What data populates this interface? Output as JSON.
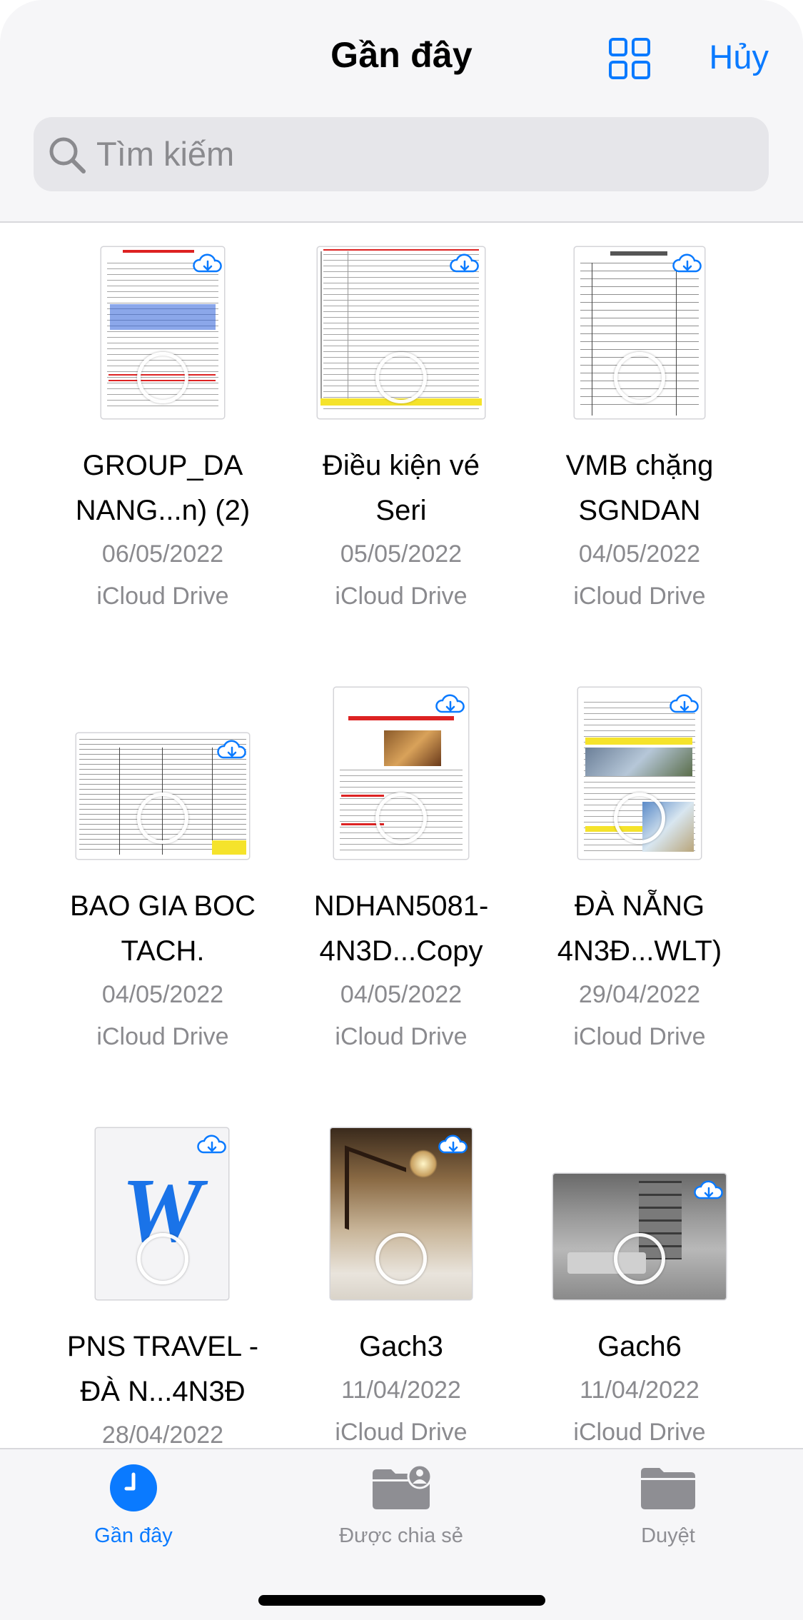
{
  "header": {
    "title": "Gần đây",
    "grid_icon": "grid-view-icon",
    "cancel_label": "Hủy"
  },
  "search": {
    "icon": "search-icon",
    "placeholder": "Tìm kiếm"
  },
  "files": [
    {
      "name_line1": "GROUP_DA",
      "name_line2": "NANG...n) (2)",
      "date": "06/05/2022",
      "location": "iCloud Drive",
      "thumb": "document"
    },
    {
      "name_line1": "Điều kiện vé",
      "name_line2": "Seri",
      "date": "05/05/2022",
      "location": "iCloud Drive",
      "thumb": "document"
    },
    {
      "name_line1": "VMB chặng",
      "name_line2": "SGNDAN",
      "date": "04/05/2022",
      "location": "iCloud Drive",
      "thumb": "document"
    },
    {
      "name_line1": "BAO GIA BOC",
      "name_line2": "TACH.",
      "date": "04/05/2022",
      "location": "iCloud Drive",
      "thumb": "spreadsheet"
    },
    {
      "name_line1": "NDHAN5081-",
      "name_line2": "4N3D...Copy",
      "date": "04/05/2022",
      "location": "iCloud Drive",
      "thumb": "document"
    },
    {
      "name_line1": "ĐÀ NẴNG",
      "name_line2": "4N3Đ...WLT)",
      "date": "29/04/2022",
      "location": "iCloud Drive",
      "thumb": "document"
    },
    {
      "name_line1": "PNS TRAVEL -",
      "name_line2": "ĐÀ N...4N3Đ",
      "date": "28/04/2022",
      "location": "",
      "thumb": "word"
    },
    {
      "name_line1": "Gach3",
      "name_line2": "",
      "date": "11/04/2022",
      "location": "iCloud Drive",
      "thumb": "photo"
    },
    {
      "name_line1": "Gach6",
      "name_line2": "",
      "date": "11/04/2022",
      "location": "iCloud Drive",
      "thumb": "photo"
    }
  ],
  "word_glyph": "W",
  "tabs": [
    {
      "label": "Gần đây",
      "icon": "clock-icon",
      "active": true
    },
    {
      "label": "Được chia sẻ",
      "icon": "shared-folder-icon",
      "active": false
    },
    {
      "label": "Duyệt",
      "icon": "folder-icon",
      "active": false
    }
  ],
  "colors": {
    "accent": "#0a7aff",
    "secondary_text": "#8a8a8e",
    "inactive_tab": "#8e8e93"
  }
}
